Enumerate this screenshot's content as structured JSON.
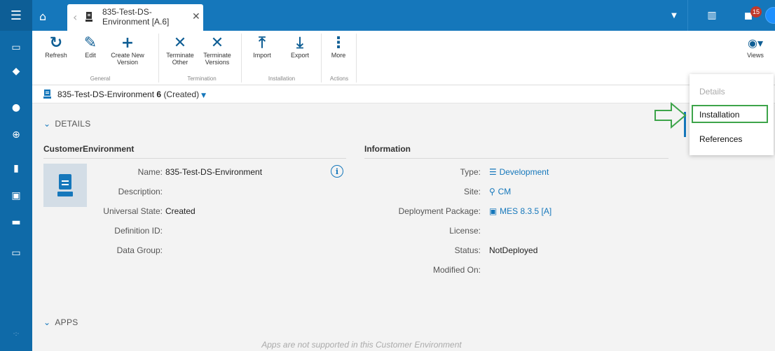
{
  "tab": {
    "title": "835-Test-DS-Environment [A.6]"
  },
  "notifications": {
    "count": "15"
  },
  "toolbar": {
    "buttons": [
      {
        "label": "Refresh",
        "icon": "refresh-icon"
      },
      {
        "label": "Edit",
        "icon": "pencil-icon"
      },
      {
        "label": "Create New Version",
        "icon": "plus-icon"
      },
      {
        "label": "Terminate Other",
        "icon": "x-icon"
      },
      {
        "label": "Terminate Versions",
        "icon": "x-icon"
      },
      {
        "label": "Import",
        "icon": "upload-icon"
      },
      {
        "label": "Export",
        "icon": "download-icon"
      },
      {
        "label": "More",
        "icon": "more-vertical-icon"
      },
      {
        "label": "Views",
        "icon": "eye-icon"
      }
    ],
    "groups": [
      "General",
      "Termination",
      "Installation",
      "Actions"
    ]
  },
  "breadcrumb": {
    "name": "835-Test-DS-Environment",
    "version": "6",
    "state": "(Created)"
  },
  "details": {
    "section_title": "DETAILS",
    "left_title": "CustomerEnvironment",
    "left_fields": [
      {
        "label": "Name:",
        "value": "835-Test-DS-Environment"
      },
      {
        "label": "Description:",
        "value": ""
      },
      {
        "label": "Universal State:",
        "value": "Created"
      },
      {
        "label": "Definition ID:",
        "value": ""
      },
      {
        "label": "Data Group:",
        "value": ""
      }
    ],
    "right_title": "Information",
    "right_fields": [
      {
        "label": "Type:",
        "value": "Development",
        "icon": "list-icon",
        "link": true
      },
      {
        "label": "Site:",
        "value": "CM",
        "icon": "location-pin-icon",
        "link": true
      },
      {
        "label": "Deployment Package:",
        "value": "MES 8.3.5 [A]",
        "icon": "package-icon",
        "link": true
      },
      {
        "label": "License:",
        "value": ""
      },
      {
        "label": "Status:",
        "value": "NotDeployed"
      },
      {
        "label": "Modified On:",
        "value": ""
      }
    ]
  },
  "apps": {
    "section_title": "APPS",
    "empty_message": "Apps are not supported in this Customer Environment"
  },
  "views_menu": {
    "items": [
      "Details",
      "Installation",
      "References"
    ]
  },
  "colors": {
    "brand": "#1577bb",
    "rail": "#0f6aa8",
    "highlight": "#3da44a",
    "badge": "#c0392b"
  }
}
